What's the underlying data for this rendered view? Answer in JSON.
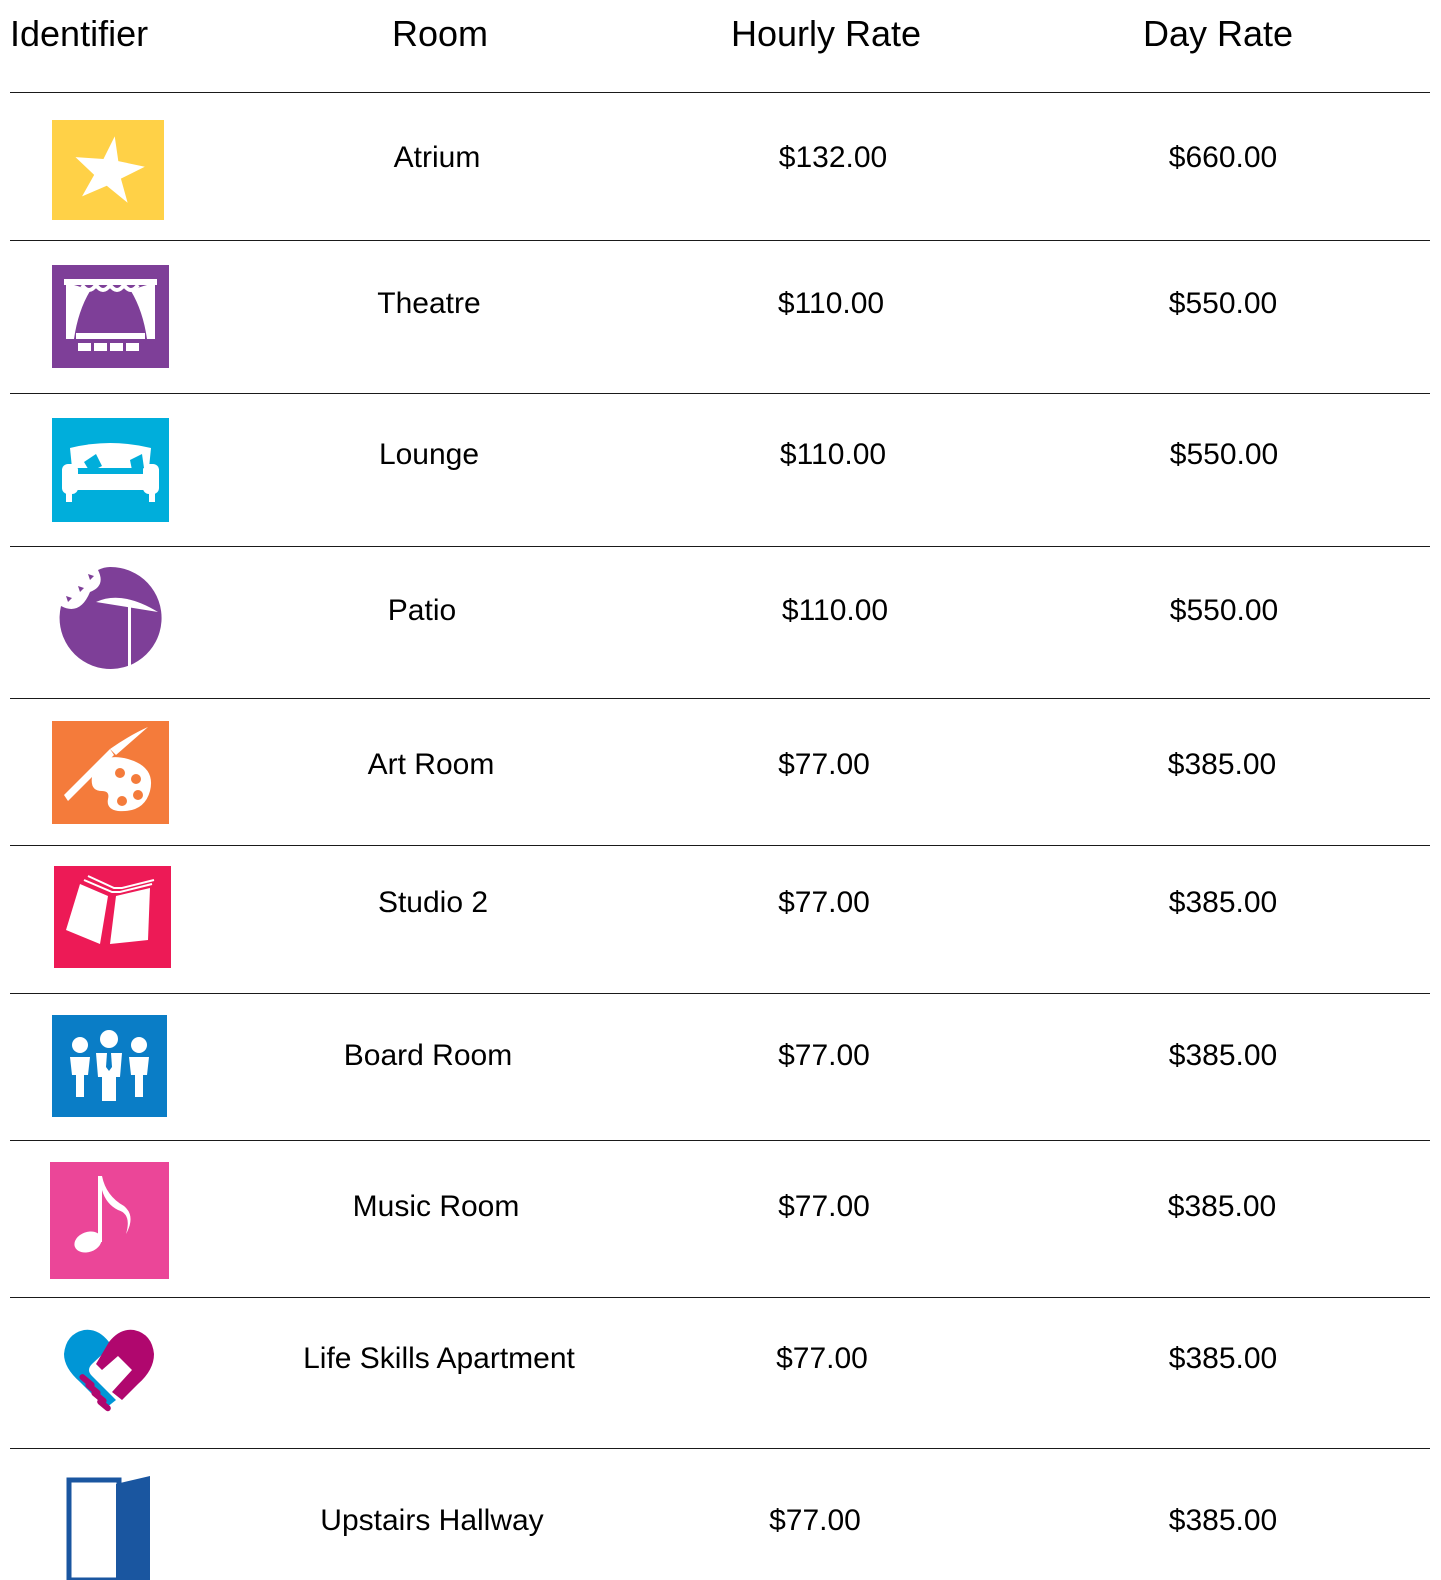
{
  "columns": {
    "identifier": "Identifier",
    "room": "Room",
    "hourly": "Hourly Rate",
    "day": "Day Rate"
  },
  "rows": [
    {
      "icon": "star-icon",
      "color": "#FFD147",
      "room": "Atrium",
      "hourly": "$132.00",
      "day": "$660.00"
    },
    {
      "icon": "theatre-stage-icon",
      "color": "#7E3F98",
      "room": "Theatre",
      "hourly": "$110.00",
      "day": "$550.00"
    },
    {
      "icon": "sofa-icon",
      "color": "#00AEDB",
      "room": "Lounge",
      "hourly": "$110.00",
      "day": "$550.00"
    },
    {
      "icon": "patio-umbrella-icon",
      "color": "#7E3F98",
      "room": "Patio",
      "hourly": "$110.00",
      "day": "$550.00"
    },
    {
      "icon": "paint-palette-icon",
      "color": "#F47B3B",
      "room": "Art Room",
      "hourly": "$77.00",
      "day": "$385.00"
    },
    {
      "icon": "open-book-icon",
      "color": "#ED1A56",
      "room": "Studio 2",
      "hourly": "$77.00",
      "day": "$385.00"
    },
    {
      "icon": "group-people-icon",
      "color": "#0A7DC6",
      "room": "Board Room",
      "hourly": "$77.00",
      "day": "$385.00"
    },
    {
      "icon": "music-note-icon",
      "color": "#EB4698",
      "room": "Music Room",
      "hourly": "$77.00",
      "day": "$385.00"
    },
    {
      "icon": "handshake-heart-icon",
      "color": "#B0076E",
      "room": "Life Skills Apartment",
      "hourly": "$77.00",
      "day": "$385.00"
    },
    {
      "icon": "open-door-icon",
      "color": "#1A56A0",
      "room": "Upstairs Hallway",
      "hourly": "$77.00",
      "day": "$385.00"
    }
  ]
}
